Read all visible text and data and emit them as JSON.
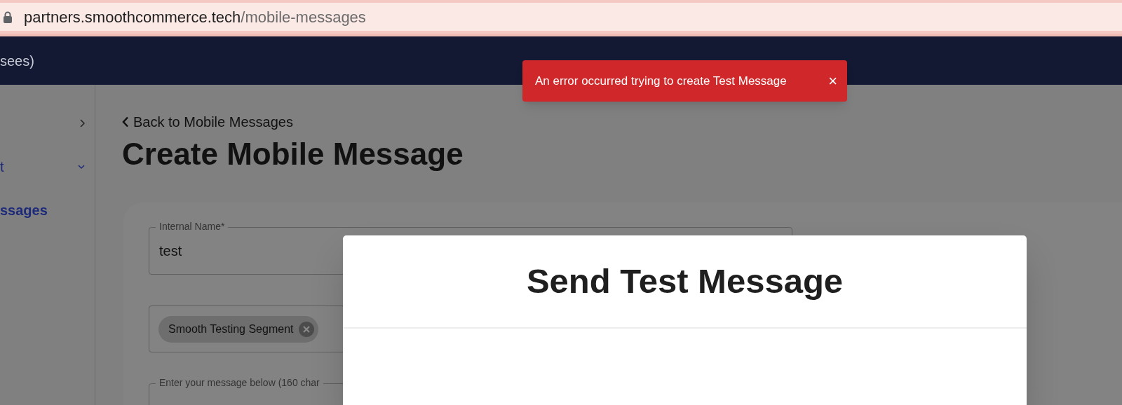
{
  "address_bar": {
    "domain": "partners.smoothcommerce.tech",
    "path": "/mobile-messages"
  },
  "top_bar": {
    "text": "sees)"
  },
  "sidebar": {
    "items": [
      {
        "kind": "expandable",
        "selected": false
      },
      {
        "kind": "collapsible",
        "label": "t",
        "selected": false
      },
      {
        "kind": "link",
        "label": "ssages",
        "selected": true
      }
    ]
  },
  "page": {
    "back_link": "Back to Mobile Messages",
    "title": "Create Mobile Message",
    "fields": [
      {
        "kind": "text",
        "label": "Internal Name*",
        "value": "test"
      },
      {
        "kind": "chips",
        "chips": [
          "Smooth Testing Segment"
        ]
      },
      {
        "kind": "textarea",
        "label": "Enter your message below (160 char"
      }
    ]
  },
  "toast": {
    "message": "An error occurred trying to create Test Message",
    "close": "×"
  },
  "modal": {
    "title": "Send Test Message"
  }
}
